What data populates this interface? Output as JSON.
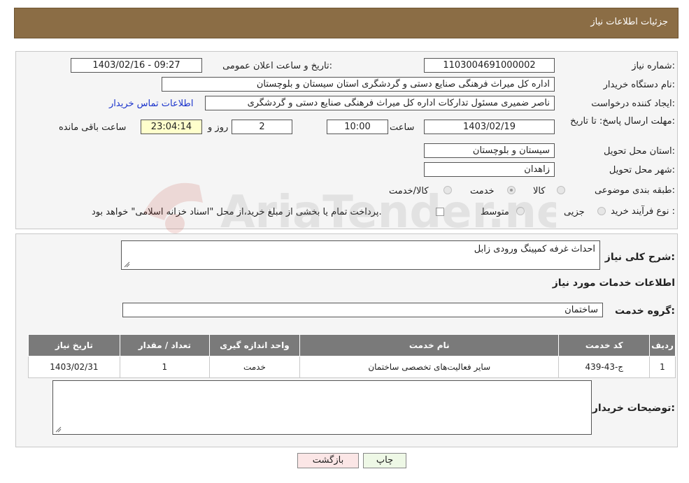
{
  "header": {
    "title": "جزئیات اطلاعات نیاز"
  },
  "form": {
    "need_number_label": "شماره نیاز:",
    "need_number": "1103004691000002",
    "announce_label": "تاریخ و ساعت اعلان عمومی:",
    "announce_value": "1403/02/16 - 09:27",
    "buyer_label": "نام دستگاه خریدار:",
    "buyer_value": "اداره کل میراث فرهنگی  صنایع دستی و گردشگری استان سیستان و بلوچستان",
    "creator_label": "ایجاد کننده درخواست:",
    "creator_value": "ناصر ضمیری مسئول تدارکات اداره کل میراث فرهنگی  صنایع دستی و گردشگری",
    "contact_link": "اطلاعات تماس خریدار",
    "deadline_label": "مهلت ارسال پاسخ: تا تاریخ:",
    "deadline_date": "1403/02/19",
    "hour_label": "ساعت",
    "deadline_time": "10:00",
    "days_value": "2",
    "days_label": "روز و",
    "remaining_time": "23:04:14",
    "remaining_label": "ساعت باقی مانده",
    "province_label": "استان محل تحویل:",
    "province_value": "سیستان و بلوچستان",
    "city_label": "شهر محل تحویل:",
    "city_value": "زاهدان",
    "category_label": "طبقه بندی موضوعی:",
    "category_options": [
      "کالا",
      "خدمت",
      "کالا/خدمت"
    ],
    "category_selected": "خدمت",
    "process_label": "نوع فرآیند خرید :",
    "process_options": [
      "جزیی",
      "متوسط"
    ],
    "payment_note": "پرداخت تمام یا بخشی از مبلغ خرید،از محل \"اسناد خزانه اسلامی\" خواهد بود."
  },
  "summary": {
    "desc_label": "شرح کلی نیاز:",
    "desc_value": "احداث غرفه کمپینگ ورودی زابل",
    "services_heading": "اطلاعات خدمات مورد نیاز",
    "group_label": "گروه خدمت:",
    "group_value": "ساختمان"
  },
  "table": {
    "headers": [
      "ردیف",
      "کد خدمت",
      "نام خدمت",
      "واحد اندازه گیری",
      "تعداد / مقدار",
      "تاریخ نیاز"
    ],
    "rows": [
      [
        "1",
        "ج-43-439",
        "سایر فعالیت‌های تخصصی ساختمان",
        "خدمت",
        "1",
        "1403/02/31"
      ]
    ]
  },
  "buyer_notes": {
    "label": "توضیحات خریدار:",
    "value": ""
  },
  "buttons": {
    "print": "چاپ",
    "back": "بازگشت"
  },
  "watermark": {
    "text": "AriaTender.neT",
    "color": "#c0392b"
  }
}
